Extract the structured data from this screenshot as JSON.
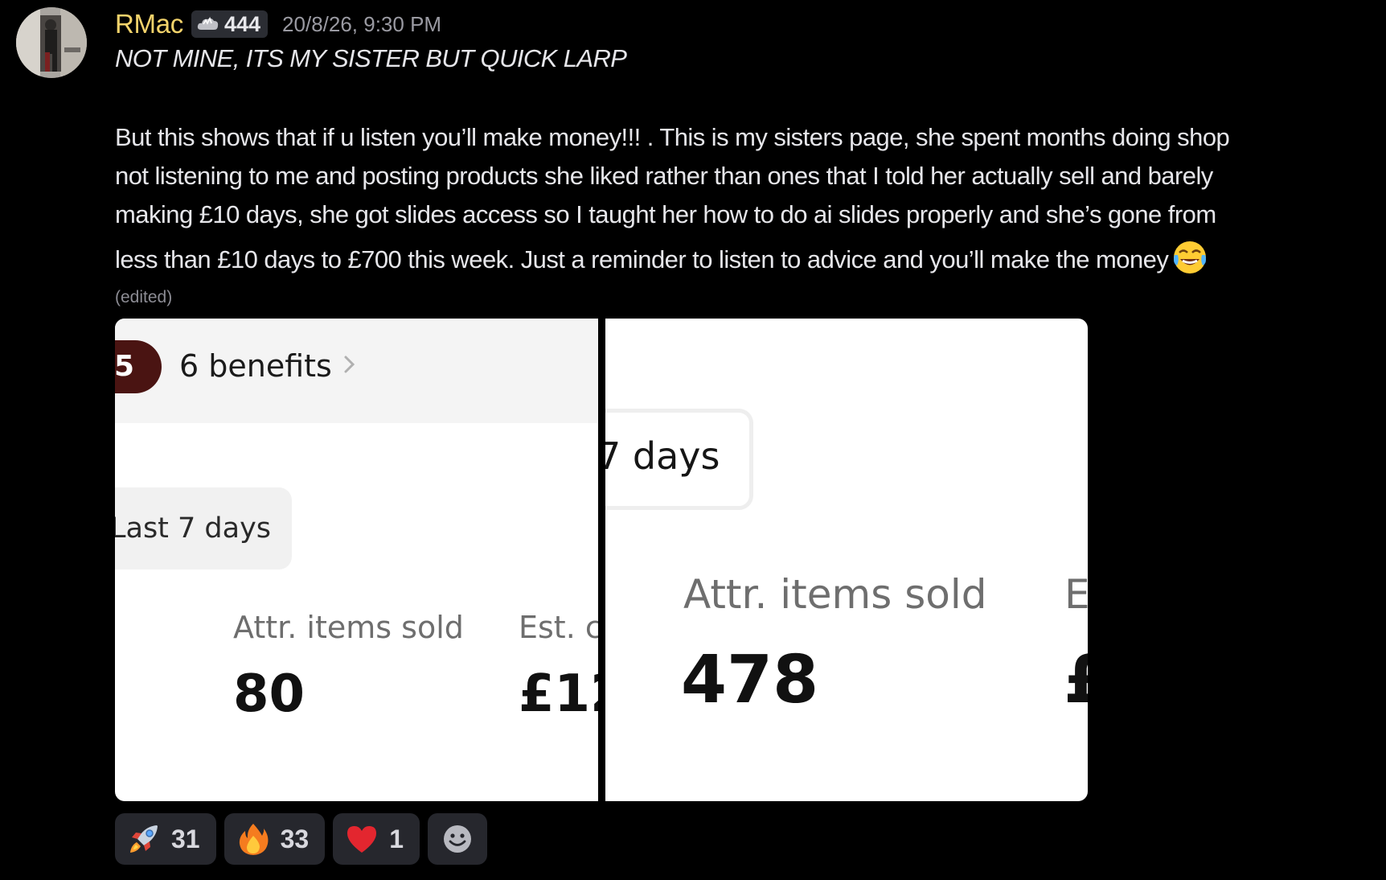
{
  "message": {
    "author": "RMac",
    "tag_count": "444",
    "timestamp": "20/8/26, 9:30 PM",
    "headline": "NOT MINE, ITS MY SISTER BUT QUICK LARP",
    "body_lines": [
      "But this shows that if u listen you’ll make money!!! . This is my sisters page, she spent months doing shop",
      "not listening to me and posting products she liked rather than ones that I told her actually sell and barely",
      "making £10 days, she got slides access so I taught her how to do ai slides properly and she’s gone from",
      "less than £10 days to £700 this week. Just a reminder to listen to advice and you’ll make the money"
    ],
    "inline_emoji": "joy-emoji",
    "edited_label": "(edited)"
  },
  "attachments": {
    "left": {
      "banner_badge": "5",
      "banner_text": "6 benefits",
      "range_label": "Last 7 days",
      "metric_1_label": "Attr. items sold",
      "metric_1_value": "80",
      "metric_2_label": "Est. c",
      "metric_2_value": "£12"
    },
    "right": {
      "range_label": "7 days",
      "metric_1_label": "Attr. items sold",
      "metric_1_value": "478",
      "metric_2_label": "E",
      "metric_2_value": "£"
    }
  },
  "reactions": [
    {
      "emoji": "rocket-emoji",
      "count": "31"
    },
    {
      "emoji": "fire-emoji",
      "count": "33"
    },
    {
      "emoji": "heart-emoji",
      "count": "1"
    }
  ],
  "colors": {
    "background": "#000000",
    "username": "#f3d36b",
    "text": "#e6e6ea",
    "muted": "#9a9aa2",
    "reaction_bg": "#26272d",
    "badge_dark_red": "#4a1412"
  }
}
